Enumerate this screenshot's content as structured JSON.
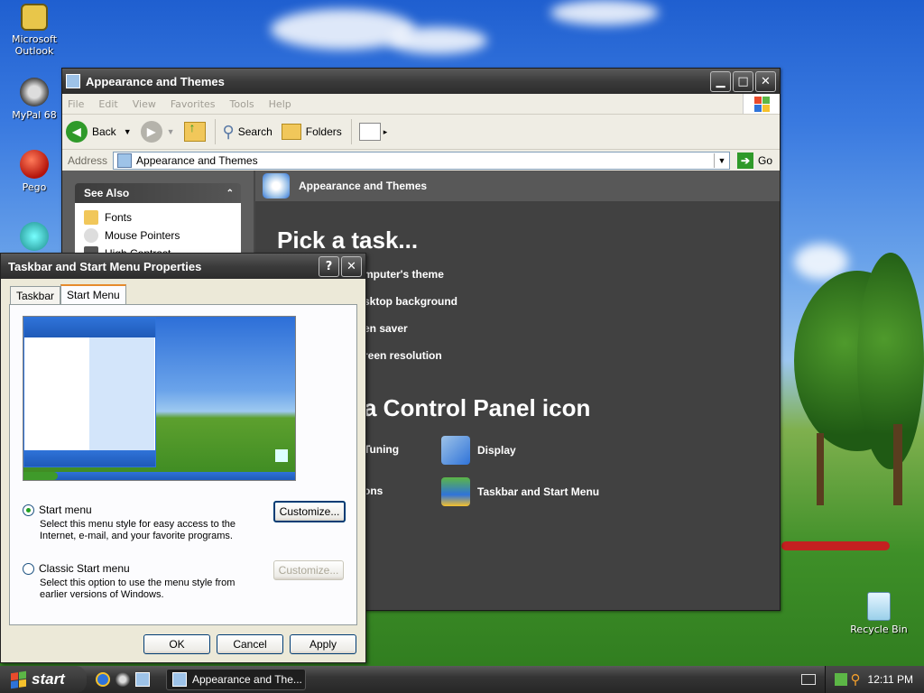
{
  "desktop": {
    "icons": [
      {
        "label": "Microsoft Outlook"
      },
      {
        "label": "MyPal 68"
      },
      {
        "label": "Pego"
      },
      {
        "label": "Recycle Bin"
      }
    ]
  },
  "explorer": {
    "title": "Appearance and Themes",
    "menu": [
      "File",
      "Edit",
      "View",
      "Favorites",
      "Tools",
      "Help"
    ],
    "toolbar": {
      "back": "Back",
      "search": "Search",
      "folders": "Folders"
    },
    "address": {
      "label": "Address",
      "value": "Appearance and Themes",
      "go": "Go"
    },
    "see_also": {
      "header": "See Also",
      "items": [
        "Fonts",
        "Mouse Pointers",
        "High Contrast"
      ]
    },
    "header": "Appearance and Themes",
    "pick_task": "Pick a task...",
    "tasks": [
      "mputer's theme",
      "sktop background",
      "en saver",
      "reen resolution"
    ],
    "pick_icon": "a Control Panel icon",
    "icons": [
      "Tuning",
      "Display",
      "ons",
      "Taskbar and Start Menu"
    ]
  },
  "dialog": {
    "title": "Taskbar and Start Menu Properties",
    "tabs": [
      "Taskbar",
      "Start Menu"
    ],
    "start_menu": {
      "label": "Start menu",
      "desc": "Select this menu style for easy access to the Internet, e-mail, and your favorite programs.",
      "customize": "Customize..."
    },
    "classic": {
      "label": "Classic Start menu",
      "desc": "Select this option to use the menu style from earlier versions of Windows.",
      "customize": "Customize..."
    },
    "buttons": {
      "ok": "OK",
      "cancel": "Cancel",
      "apply": "Apply"
    }
  },
  "taskbar": {
    "start": "start",
    "task": "Appearance and The...",
    "clock": "12:11 PM"
  }
}
